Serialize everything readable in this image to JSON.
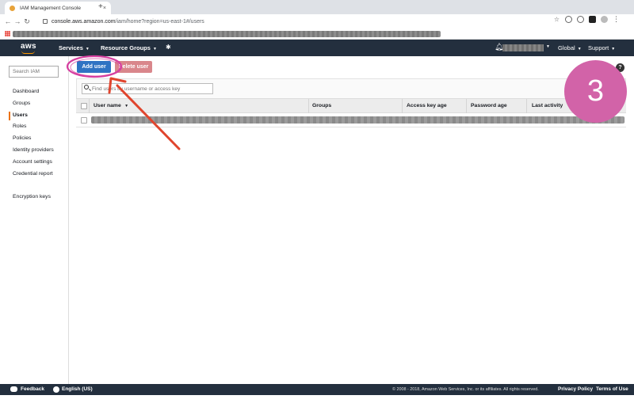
{
  "browser": {
    "tab_title": "IAM Management Console",
    "tab_close": "×",
    "new_tab": "+",
    "url_host": "console.aws.amazon.com",
    "url_path": "/iam/home?region=us-east-1#/users"
  },
  "aws_nav": {
    "logo": "aws",
    "services": "Services",
    "resource_groups": "Resource Groups",
    "region": "Global",
    "support": "Support"
  },
  "sidebar": {
    "search_placeholder": "Search IAM",
    "items": [
      {
        "label": "Dashboard"
      },
      {
        "label": "Groups"
      },
      {
        "label": "Users",
        "active": true
      },
      {
        "label": "Roles"
      },
      {
        "label": "Policies"
      },
      {
        "label": "Identity providers"
      },
      {
        "label": "Account settings"
      },
      {
        "label": "Credential report"
      }
    ],
    "encryption_keys": "Encryption keys"
  },
  "toolbar": {
    "add_user": "Add user",
    "delete_user": "Delete user",
    "help": "?"
  },
  "users_table": {
    "filter_placeholder": "Find users by username or access key",
    "columns": [
      "User name",
      "Groups",
      "Access key age",
      "Password age",
      "Last activity"
    ]
  },
  "footer": {
    "feedback": "Feedback",
    "language": "English (US)",
    "copyright": "© 2008 - 2018, Amazon Web Services, Inc. or its affiliates. All rights reserved.",
    "privacy": "Privacy Policy",
    "terms": "Terms of Use"
  },
  "annotation": {
    "step_number": "3",
    "colors": {
      "badge": "#d263a8",
      "arrow": "#e0452e",
      "circle": "#d63fa0"
    }
  },
  "colors": {
    "aws_nav_bg": "#232f3e",
    "aws_orange": "#ff9900",
    "primary_button": "#2f73c3",
    "danger_button_disabled": "#d9868b"
  }
}
